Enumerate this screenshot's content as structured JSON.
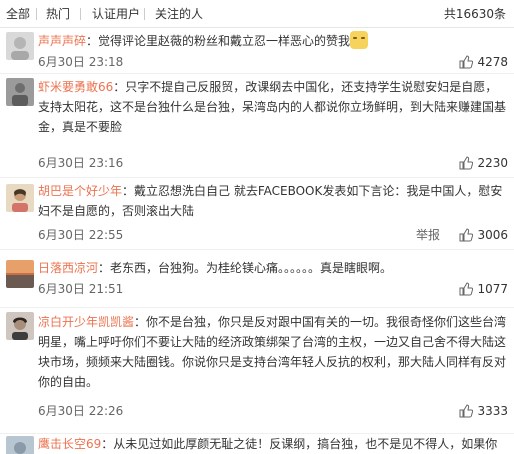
{
  "tabs": {
    "all": "全部",
    "hot": "热门",
    "verified": "认证用户",
    "following": "关注的人",
    "total": "共16630条"
  },
  "comments": [
    {
      "user": "声声声碎",
      "text": "：觉得评论里赵薇的粉丝和戴立忍一样恶心的赞我",
      "time": "6月30日 23:18",
      "likes": "4278"
    },
    {
      "user": "虾米要勇敢66",
      "text": "：只字不提自己反服贸，改课纲去中国化，还支持学生说慰安妇是自愿，支持太阳花，这不是台独什么是台独，呆湾岛内的人都说你立场鲜明，到大陆来赚建国基金，真是不要脸",
      "time": "6月30日 23:16",
      "likes": "2230"
    },
    {
      "user": "胡巴是个好少年",
      "text": "：戴立忍想洗白自己 就去FACEBOOK发表如下言论：我是中国人，慰安妇不是自愿的，否则滚出大陆",
      "time": "6月30日 22:55",
      "report": "举报",
      "likes": "3006"
    },
    {
      "user": "日落西凉河",
      "text": "：老东西，台独狗。为桂纶镁心痛。。。。。。真是瞎眼啊。",
      "time": "6月30日 21:51",
      "likes": "1077"
    },
    {
      "user": "凉白开少年凯凯酱",
      "text": "：你不是台独，你只是反对跟中国有关的一切。我很奇怪你们这些台湾明星，嘴上呼吁你们不要让大陆的经济政策绑架了台湾的主权，一边又自己舍不得大陆这块市场，频频来大陆圈钱。你说你只是支持台湾年轻人反抗的权利，那大陆人同样有反对你的自由。",
      "time": "6月30日 22:26",
      "likes": "3333"
    },
    {
      "user": "鹰击长空69",
      "text": "：从未见过如此厚颜无耻之徒！反课纲，搞台独，也不是见不得人，如果你",
      "time": "",
      "likes": ""
    }
  ]
}
